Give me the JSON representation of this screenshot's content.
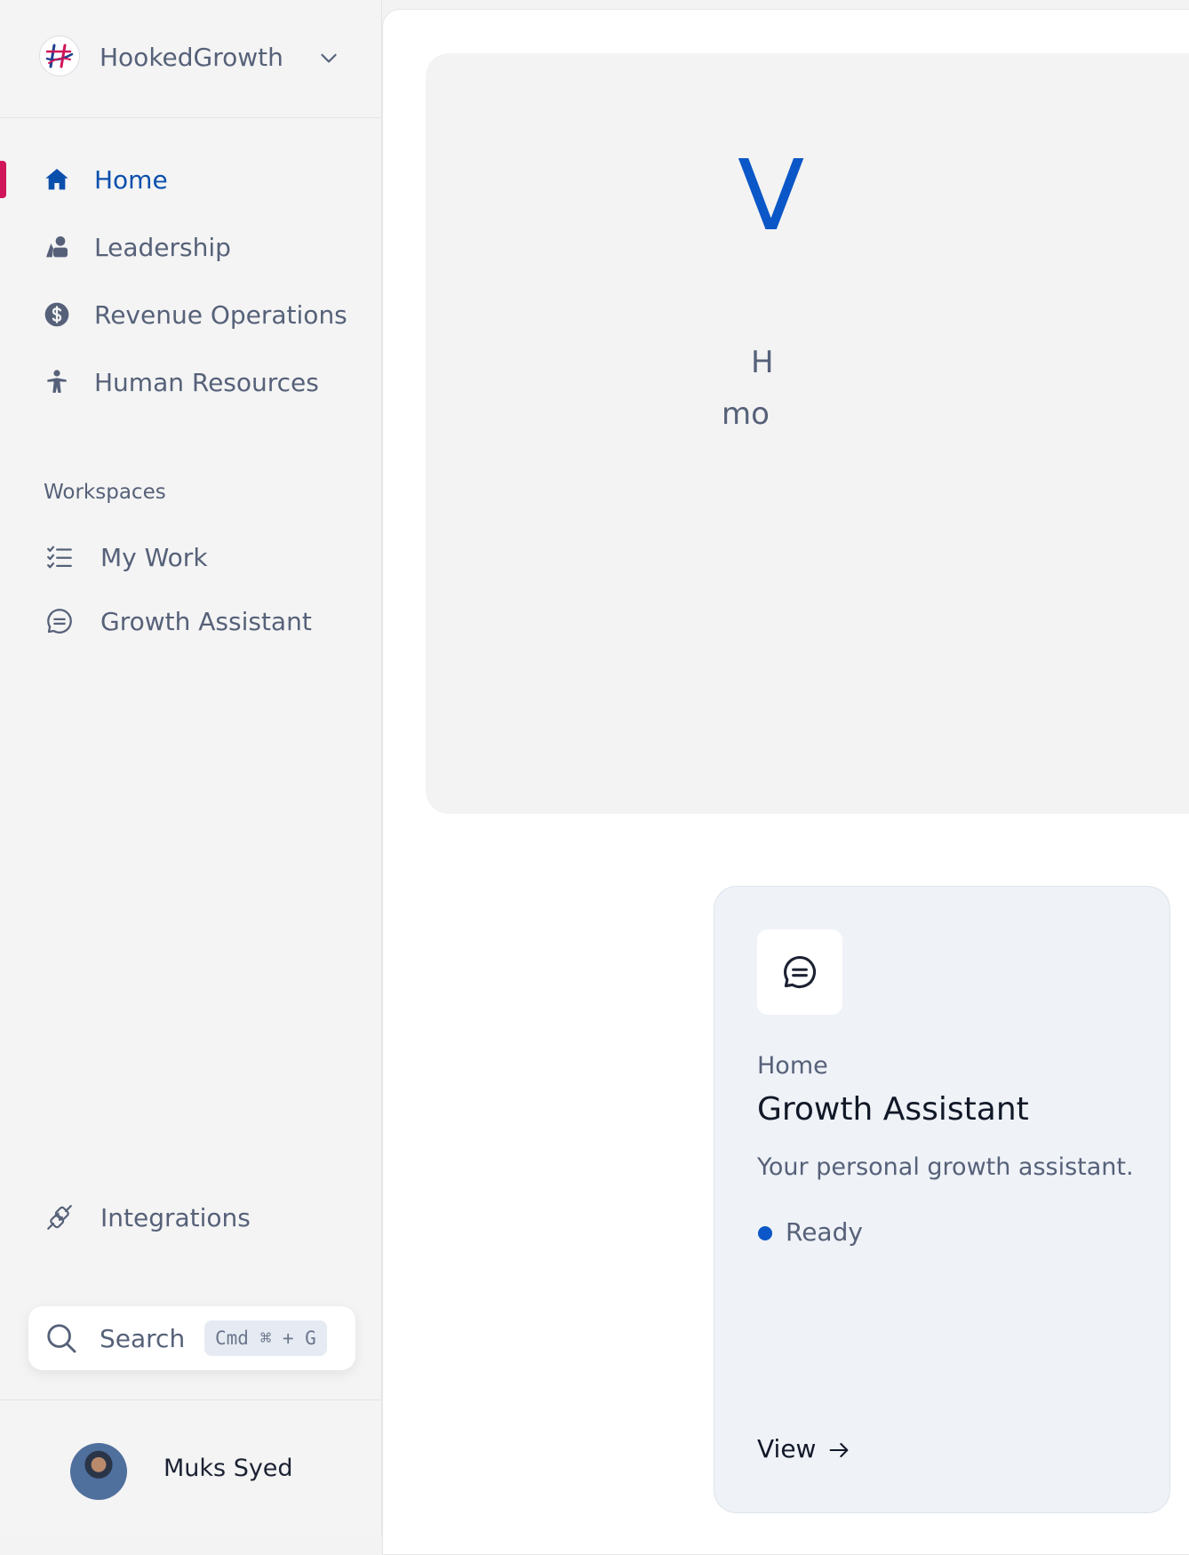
{
  "workspace": {
    "name": "HookedGrowth",
    "logo_icon": "hookedgrowth-logo",
    "dropdown_icon": "chevron-down-icon"
  },
  "nav": {
    "items": [
      {
        "label": "Home",
        "icon": "home-icon",
        "active": true
      },
      {
        "label": "Leadership",
        "icon": "leadership-icon",
        "active": false
      },
      {
        "label": "Revenue Operations",
        "icon": "dollar-circle-icon",
        "active": false
      },
      {
        "label": "Human Resources",
        "icon": "person-icon",
        "active": false
      }
    ]
  },
  "workspaces": {
    "section_label": "Workspaces",
    "items": [
      {
        "label": "My Work",
        "icon": "checklist-icon"
      },
      {
        "label": "Growth Assistant",
        "icon": "chat-icon"
      }
    ]
  },
  "integrations": {
    "label": "Integrations",
    "icon": "plug-icon"
  },
  "search": {
    "label": "Search",
    "shortcut": "Cmd ⌘ + G",
    "icon": "search-icon"
  },
  "user": {
    "name": "Muks Syed"
  },
  "hero": {
    "big_letter": "V",
    "line1": "H",
    "line2": "mo"
  },
  "card": {
    "icon": "chat-icon",
    "breadcrumb": "Home",
    "title": "Growth Assistant",
    "description": "Your personal growth assistant.",
    "status": "Ready",
    "link": "View"
  },
  "colors": {
    "accent": "#0b4fad",
    "active_marker": "#d0155a",
    "text_muted": "#566179",
    "sidebar_bg": "#f4f4f4",
    "card_bg": "#eff2f7"
  }
}
